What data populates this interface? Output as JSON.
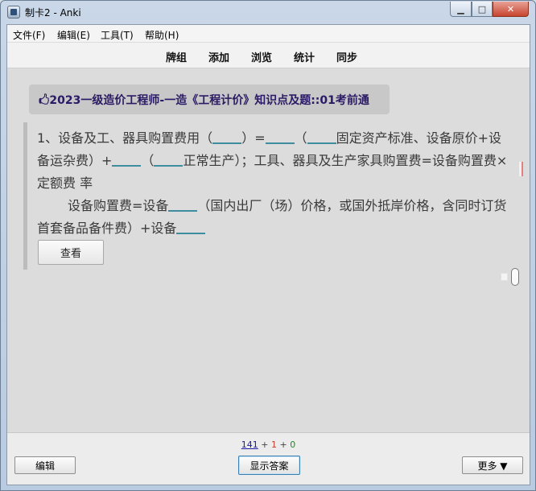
{
  "window": {
    "title": "制卡2 - Anki"
  },
  "menu": {
    "file": "文件(F)",
    "edit": "编辑(E)",
    "tools": "工具(T)",
    "help": "帮助(H)"
  },
  "toolbar": {
    "decks": "牌组",
    "add": "添加",
    "browse": "浏览",
    "stats": "统计",
    "sync": "同步"
  },
  "card": {
    "deck_tag": "🖒2023一级造价工程师-一造《工程计价》知识点及题::01考前通",
    "p1_a": "1、设备及工、器具购置费用（",
    "p1_b": "）=",
    "p1_c": "（",
    "p1_d": "固定资产标准、设备原价+设备运杂费）+",
    "p1_e": "（",
    "p1_f": "正常生产）；工具、器具及生产家具购置费=设备购置费×定额费 率",
    "p2_a": "设备购置费=设备",
    "p2_b": "（国内出厂（场）价格，或国外抵岸价格，含同时订货首套备品备件费）+设备",
    "view_label": "查看"
  },
  "counts": {
    "new": "141",
    "sep1": " + ",
    "learn": "1",
    "sep2": " + ",
    "review": "0"
  },
  "bottom": {
    "edit_label": "编辑",
    "show_answer_label": "显示答案",
    "more_label": "更多 ▼"
  }
}
